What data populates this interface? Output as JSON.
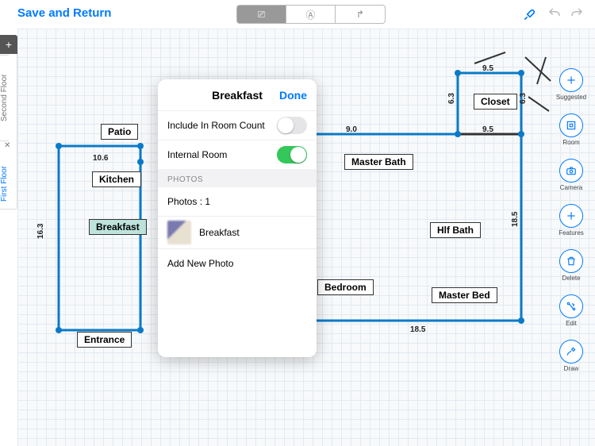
{
  "header": {
    "save": "Save and Return",
    "seg1": "⎚",
    "seg2": "Ⓐ",
    "seg3": "↱"
  },
  "floors": {
    "second": "Second Floor",
    "first": "First Floor"
  },
  "tools": {
    "suggested": "Suggested",
    "room": "Room",
    "camera": "Camera",
    "features": "Features",
    "delete": "Delete",
    "edit": "Edit",
    "draw": "Draw"
  },
  "rooms": {
    "patio": "Patio",
    "kitchen": "Kitchen",
    "breakfast": "Breakfast",
    "entrance": "Entrance",
    "masterBath": "Master Bath",
    "hlfBath": "Hlf Bath",
    "closet": "Closet",
    "bedroom": "Bedroom",
    "masterBed": "Master Bed"
  },
  "dims": {
    "d10_6": "10.6",
    "d16_3": "16.3",
    "d9_0": "9.0",
    "d9_5a": "9.5",
    "d9_5b": "9.5",
    "d6_3a": "6.3",
    "d6_3b": "6.3",
    "d18_5a": "18.5",
    "d18_5b": "18.5"
  },
  "popup": {
    "title": "Breakfast",
    "done": "Done",
    "includeCount": "Include In Room Count",
    "includeCountValue": false,
    "internal": "Internal Room",
    "internalValue": true,
    "photosSection": "PHOTOS",
    "photosCount": "Photos : 1",
    "photoName": "Breakfast",
    "addPhoto": "Add New Photo"
  }
}
